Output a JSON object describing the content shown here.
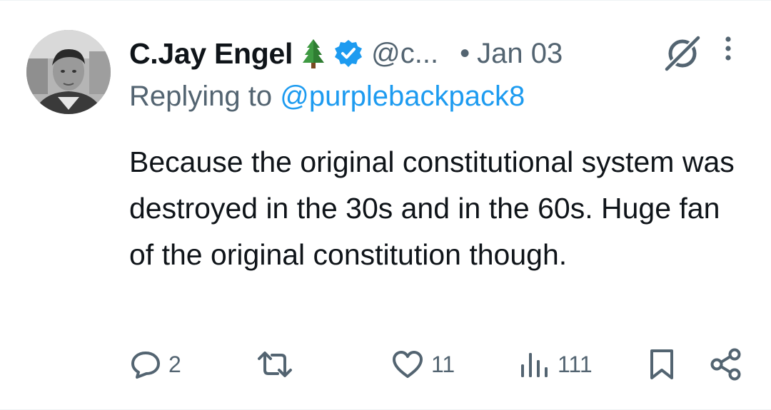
{
  "tweet": {
    "author_name": "C.Jay Engel",
    "author_emoji": "🌲",
    "handle": "@c...",
    "separator": "•",
    "date": "Jan 03",
    "replying_prefix": "Replying to ",
    "replying_to": "@purplebackpack8",
    "text": "Because the original constitutional system was destroyed in the 30s and in the 60s. Huge fan of the original constitution though."
  },
  "icons": {
    "avatar": "profile-photo",
    "badge": "verified-icon",
    "menu": "more-vertical-icon",
    "grok": "grok-icon"
  },
  "actions": {
    "replies": "2",
    "reposts": "",
    "likes": "11",
    "views": "111"
  },
  "colors": {
    "text": "#0f1419",
    "secondary": "#536471",
    "link": "#1d9bf0",
    "verified": "#1d9bf0"
  }
}
